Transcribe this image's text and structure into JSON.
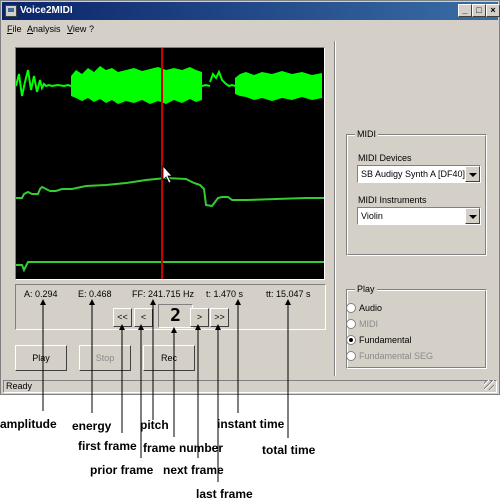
{
  "window": {
    "title": "Voice2MIDI",
    "controls": [
      "_",
      "□",
      "×"
    ]
  },
  "menu": [
    "File",
    "Analysis",
    "View",
    "?"
  ],
  "info": {
    "amplitude": "A:  0.294",
    "energy": "E:  0.468",
    "pitch": "FF:  241.715 Hz",
    "instant_time": "t:  1.470 s",
    "total_time": "tt:  15.047 s"
  },
  "nav": {
    "first": "<<",
    "prior": "<",
    "frame_number": "2",
    "next": ">",
    "last": ">>"
  },
  "buttons": {
    "play": "Play",
    "stop": "Stop",
    "rec": "Rec"
  },
  "status": "Ready",
  "midi": {
    "group_title": "MIDI",
    "devices_label": "MIDI Devices",
    "device_selected": "SB Audigy Synth A [DF40]",
    "instruments_label": "MIDI Instruments",
    "instrument_selected": "Violin"
  },
  "play_group": {
    "title": "Play",
    "options": [
      "Audio",
      "MIDI",
      "Fundamental",
      "Fundamental SEG"
    ],
    "selected": "Fundamental"
  },
  "annotations": {
    "amplitude": "amplitude",
    "energy": "energy",
    "first_frame": "first frame",
    "pitch": "pitch",
    "prior_frame": "prior frame",
    "frame_number": "frame number",
    "next_frame": "next frame",
    "last_frame": "last frame",
    "instant_time": "instant time",
    "total_time": "total time"
  },
  "colors": {
    "waveform": "#00ff00",
    "cursor": "#cc0000",
    "scope_bg": "#000000",
    "titlebar": "#0a246a"
  }
}
